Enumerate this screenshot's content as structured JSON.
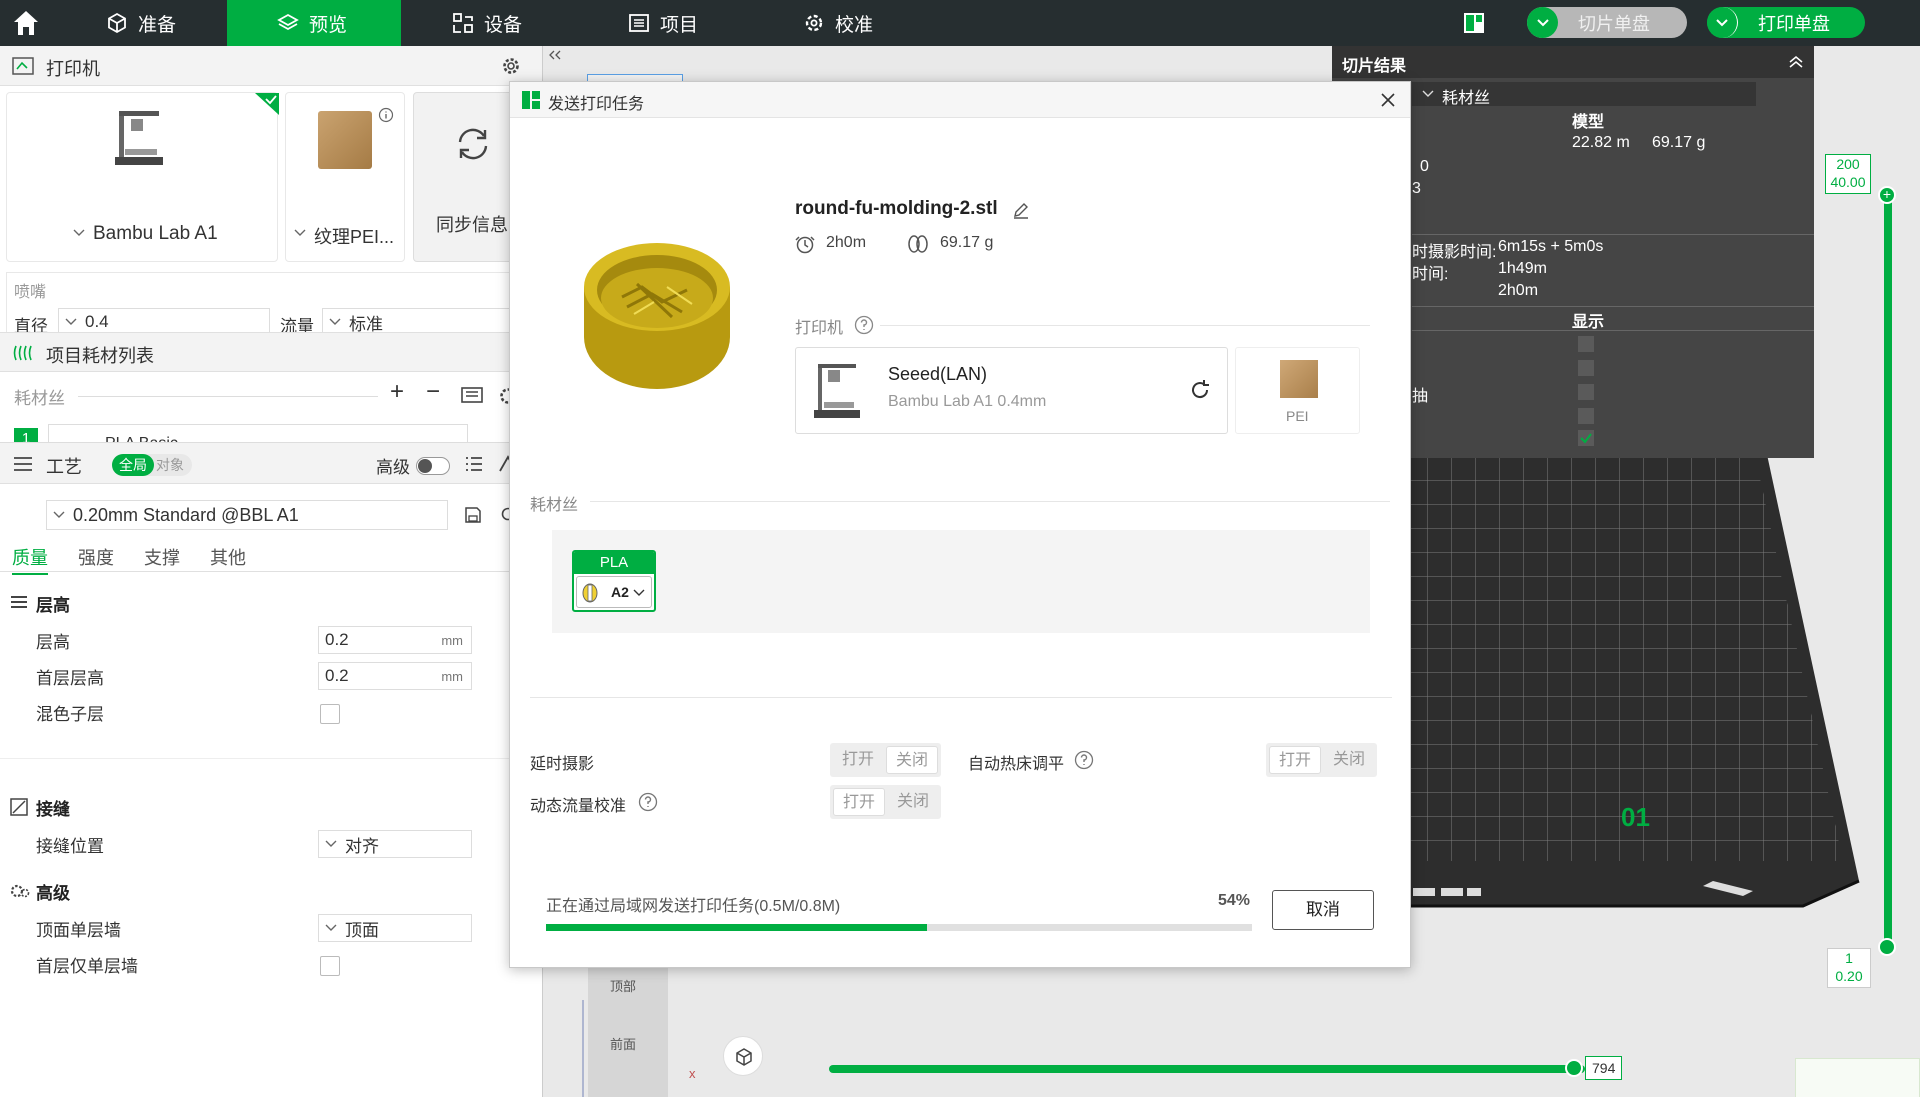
{
  "topbar": {
    "tabs": [
      {
        "label": "准备",
        "icon": "cube-icon"
      },
      {
        "label": "预览",
        "icon": "layers-icon"
      },
      {
        "label": "设备",
        "icon": "device-icon"
      },
      {
        "label": "项目",
        "icon": "list-icon"
      },
      {
        "label": "校准",
        "icon": "calibration-icon"
      }
    ],
    "slice_plate_label": "切片单盘",
    "print_plate_label": "打印单盘",
    "accent": "#00ae42"
  },
  "printer_section": {
    "title": "打印机",
    "printer_name": "Bambu Lab A1",
    "plate_name": "纹理PEI...",
    "sync_label": "同步信息",
    "nozzle_title": "喷嘴",
    "diameter_label": "直径",
    "diameter_value": "0.4",
    "flow_label": "流量",
    "flow_value": "标准"
  },
  "filament_section": {
    "title": "项目耗材列表",
    "filament_label": "耗材丝",
    "add_label": "+",
    "remove_label": "−",
    "slot_number": "1",
    "filament_name": "PLA Basic"
  },
  "process_section": {
    "title": "工艺",
    "global_label": "全局",
    "object_label": "对象",
    "advanced_label": "高级",
    "preset": "0.20mm Standard @BBL A1",
    "tabs": [
      "质量",
      "强度",
      "支撑",
      "其他"
    ],
    "groups": {
      "layer_title": "层高",
      "layer_height_label": "层高",
      "layer_height_value": "0.2",
      "first_layer_label": "首层层高",
      "first_layer_value": "0.2",
      "unit": "mm",
      "mixed_layer_label": "混色子层",
      "seam_title": "接缝",
      "seam_pos_label": "接缝位置",
      "seam_pos_value": "对齐",
      "advanced_title": "高级",
      "top_wall_label": "顶面单层墙",
      "top_wall_value": "顶面",
      "first_layer_wall_label": "首层仅单层墙"
    }
  },
  "slice_result": {
    "title": "切片结果",
    "filament_dropdown": "耗材丝",
    "model_header": "模型",
    "length": "22.82 m",
    "weight": "69.17 g",
    "row_a": "0",
    "row_b": "3",
    "timelapse_label": "时摄影时间:",
    "timelapse_value": "6m15s + 5m0s",
    "time_label": "时间:",
    "time_value": "1h49m",
    "total_value": "2h0m",
    "display_header": "显示",
    "side_text": "抽"
  },
  "viewport": {
    "plate_number": "01",
    "view_top": "顶部",
    "view_front": "前面",
    "axis_x": "x",
    "layer_top_max": "200",
    "layer_top_height": "40.00",
    "layer_bottom_min": "1",
    "layer_bottom_height": "0.20",
    "move_count": "794"
  },
  "dialog": {
    "title": "发送打印任务",
    "file_name": "round-fu-molding-2.stl",
    "print_time": "2h0m",
    "weight": "69.17 g",
    "printer_header": "打印机",
    "printer_name": "Seeed(LAN)",
    "printer_model": "Bambu Lab A1  0.4mm",
    "plate_label": "PEI",
    "filament_header": "耗材丝",
    "filament_type": "PLA",
    "filament_slot": "A2",
    "filament_color": "#f0d033",
    "timelapse_label": "延时摄影",
    "auto_level_label": "自动热床调平",
    "flow_calib_label": "动态流量校准",
    "on_label": "打开",
    "off_label": "关闭",
    "progress_text": "正在通过局域网发送打印任务(0.5M/0.8M)",
    "progress_percent": "54%",
    "progress_value": 0.54,
    "cancel_label": "取消"
  }
}
